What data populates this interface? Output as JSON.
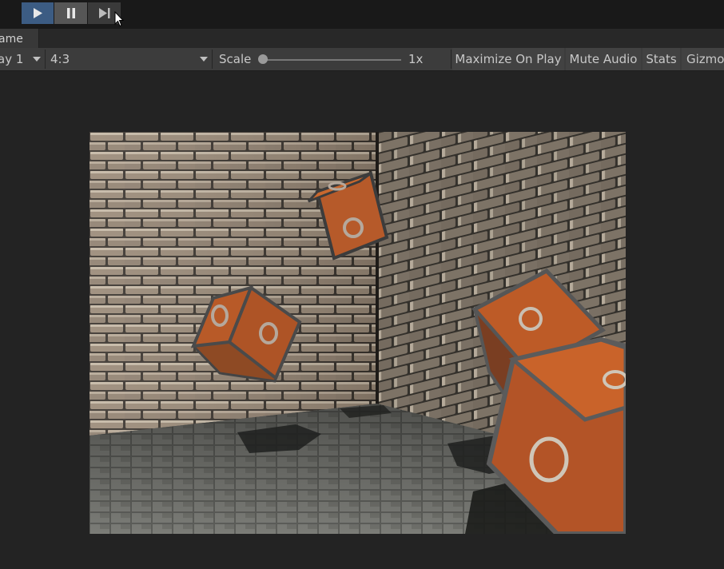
{
  "playbar": {
    "play_icon": "play-icon",
    "pause_icon": "pause-icon",
    "step_icon": "step-forward-icon",
    "accent_color": "#3c5c83"
  },
  "tab": {
    "label": "ame"
  },
  "toolbar": {
    "display": "ay 1",
    "aspect": "4:3",
    "scale_label": "Scale",
    "scale_value": "1x",
    "maximize_label": "Maximize On Play",
    "mute_label": "Mute Audio",
    "stats_label": "Stats",
    "gizmos_label": "Gizmo"
  }
}
